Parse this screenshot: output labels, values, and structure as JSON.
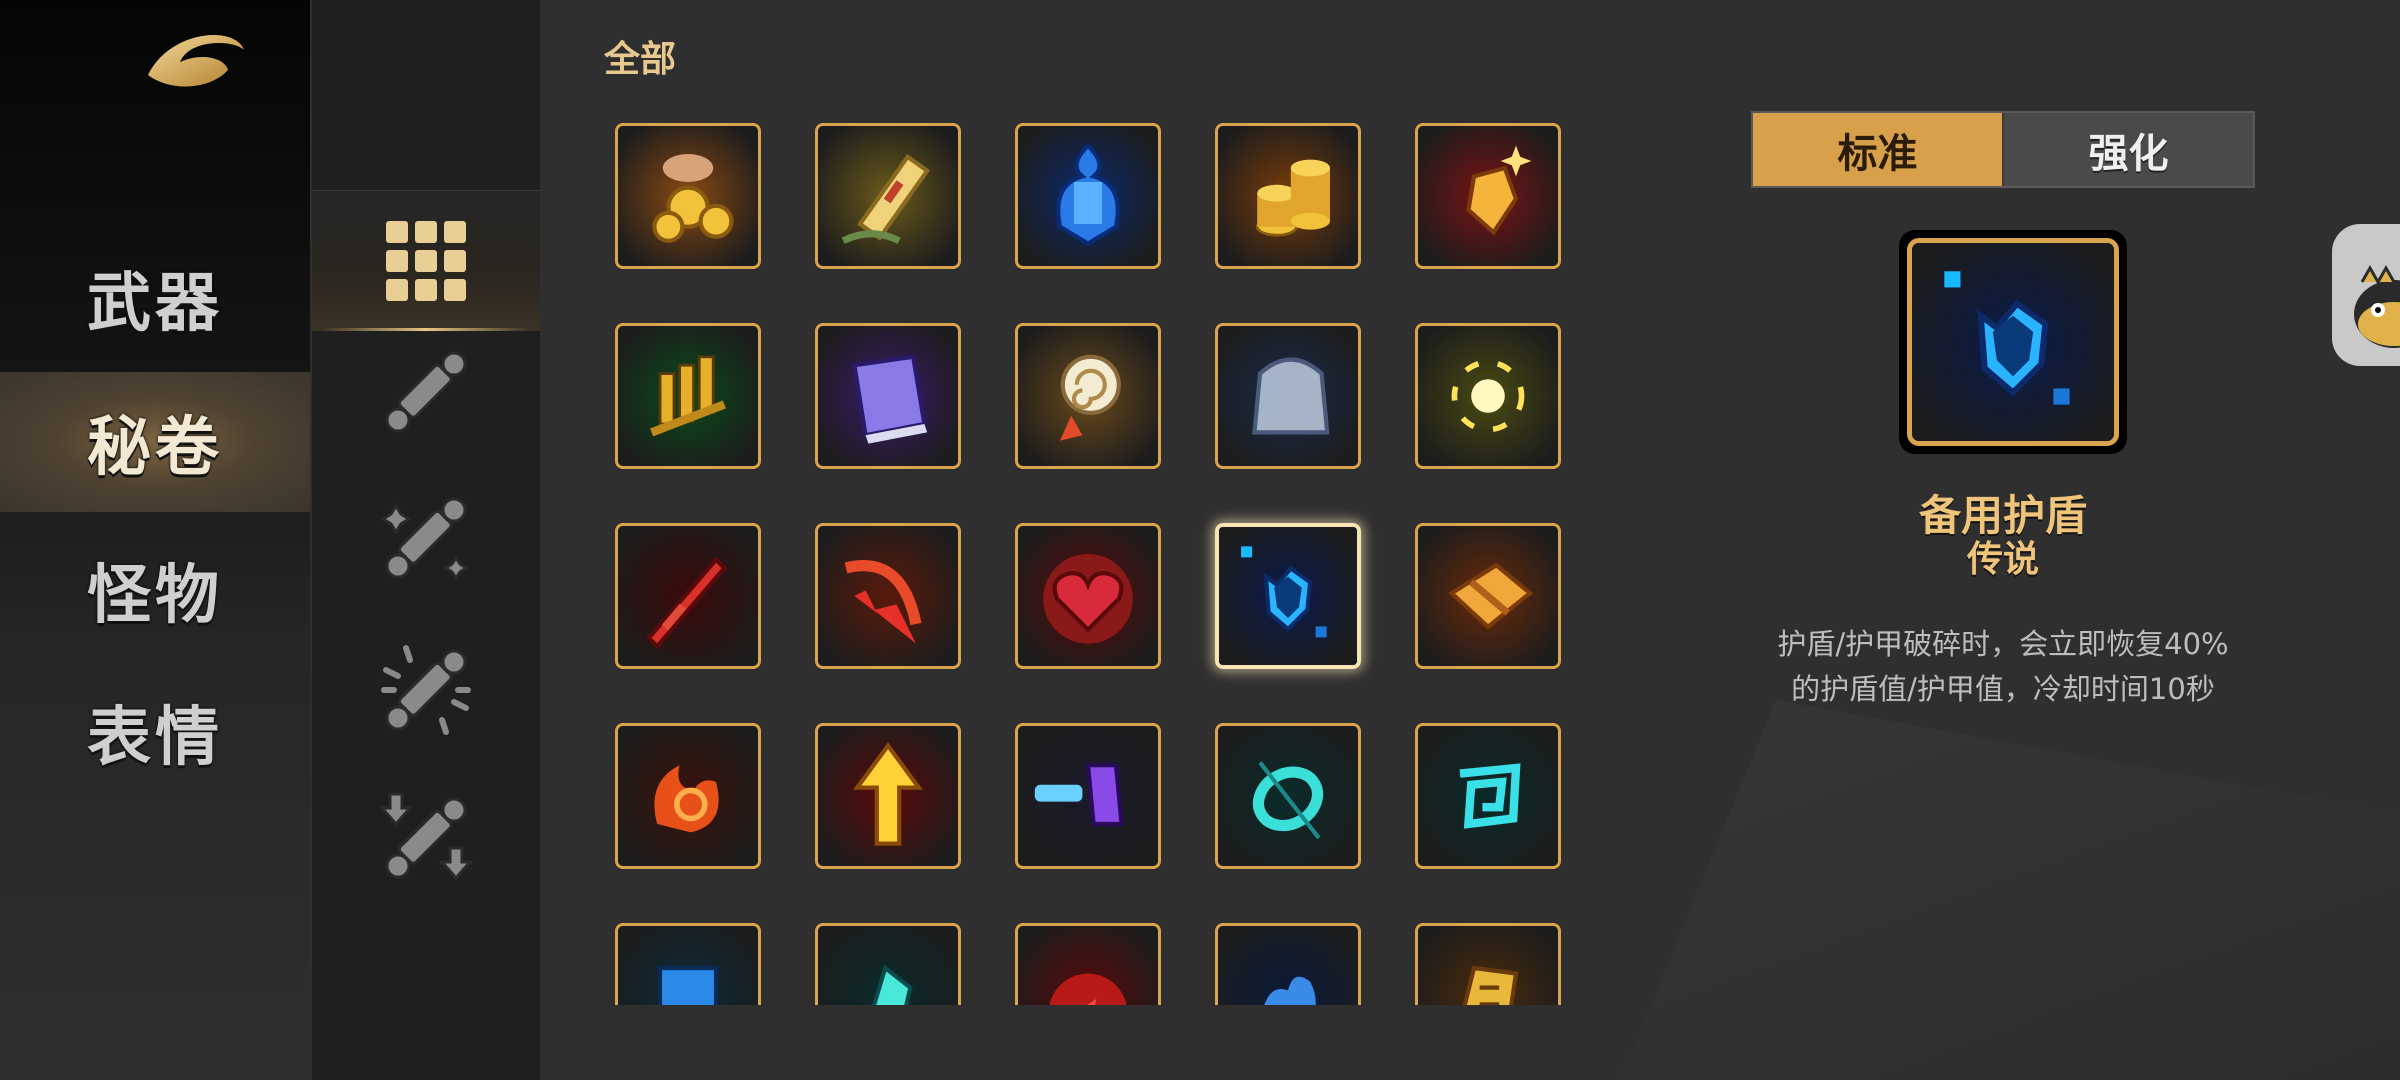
{
  "nav": {
    "categories": [
      {
        "label": "武器"
      },
      {
        "label": "秘卷"
      },
      {
        "label": "怪物"
      },
      {
        "label": "表情"
      }
    ],
    "active_category": "秘卷"
  },
  "sub_filters": [
    {
      "icon": "grid-all-icon"
    },
    {
      "icon": "scroll-plain-icon"
    },
    {
      "icon": "scroll-sparkle-icon"
    },
    {
      "icon": "scroll-burst-icon"
    },
    {
      "icon": "scroll-down-arrows-icon"
    }
  ],
  "section": {
    "label": "全部"
  },
  "grid": {
    "items": [
      {
        "icon": "gold-coins-hand-icon",
        "bg": "#8a4a12"
      },
      {
        "icon": "golden-scroll-icon",
        "bg": "#6a5a1a"
      },
      {
        "icon": "blue-potion-icon",
        "bg": "#0a2a6a"
      },
      {
        "icon": "coin-stack-icon",
        "bg": "#7a3c0a"
      },
      {
        "icon": "red-crystal-icon",
        "bg": "#7a1212"
      },
      {
        "icon": "green-bullets-icon",
        "bg": "#0a4a1a"
      },
      {
        "icon": "purple-book-icon",
        "bg": "#3a1a6a"
      },
      {
        "icon": "spiral-scroll-icon",
        "bg": "#6a4a1a"
      },
      {
        "icon": "grey-stone-icon",
        "bg": "#1a2a4a"
      },
      {
        "icon": "yellow-spark-icon",
        "bg": "#4a4a12"
      },
      {
        "icon": "red-sword-icon",
        "bg": "#3a0a0a"
      },
      {
        "icon": "red-slash-icon",
        "bg": "#5a1a0a"
      },
      {
        "icon": "red-heart-icon",
        "bg": "#5a0a0a"
      },
      {
        "icon": "blue-shield-icon",
        "bg": "#0a1a4a"
      },
      {
        "icon": "golden-bundle-icon",
        "bg": "#6a2a0a"
      },
      {
        "icon": "fire-cycle-icon",
        "bg": "#3a120a"
      },
      {
        "icon": "yellow-arrow-icon",
        "bg": "#5a0a0a"
      },
      {
        "icon": "purple-blaster-icon",
        "bg": "#1a1a2a"
      },
      {
        "icon": "teal-ring-icon",
        "bg": "#0a2a2a"
      },
      {
        "icon": "teal-spiral-icon",
        "bg": "#0a2a2a"
      },
      {
        "icon": "blue-helmet-icon",
        "bg": "#0a2a3a"
      },
      {
        "icon": "teal-crystal-icon",
        "bg": "#0a2a2a"
      },
      {
        "icon": "red-orb-icon",
        "bg": "#5a0a0a"
      },
      {
        "icon": "blue-splash-icon",
        "bg": "#0a1a3a"
      },
      {
        "icon": "golden-rune-icon",
        "bg": "#4a2a0a"
      }
    ],
    "selected_index": 13
  },
  "detail": {
    "tabs": [
      {
        "label": "标准"
      },
      {
        "label": "强化"
      }
    ],
    "active_tab": "标准",
    "icon": "blue-shield-icon",
    "name": "备用护盾",
    "rarity": "传说",
    "description": "护盾/护甲破碎时，会立即恢复40%的护盾值/护甲值，冷却时间10秒"
  },
  "side_tab": {
    "icon": "mascot-icon"
  },
  "colors": {
    "accent": "#d9a44e",
    "title_gold": "#f0c47a",
    "active_tab": "#d8a04a"
  }
}
